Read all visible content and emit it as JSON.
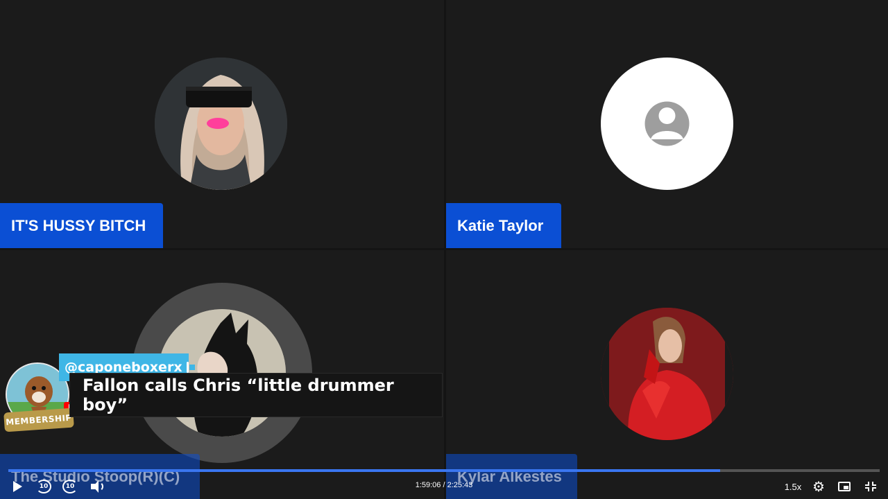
{
  "participants": [
    {
      "name": "IT'S HUSSY BITCH",
      "avatar": "photo-woman-sunglasses"
    },
    {
      "name": "Katie Taylor",
      "avatar": "default-person-icon"
    },
    {
      "name": "The Studio Stoop(R)(C)",
      "avatar": "illustration-cat-ear-woman"
    },
    {
      "name": "Kylar Alkestes",
      "avatar": "photo-woman-red-dress"
    }
  ],
  "comment": {
    "handle": "@caponeboxerx",
    "badge_label": "MEMBERSHIP",
    "text": "Fallon calls Chris “little drummer boy”"
  },
  "player": {
    "current_time": "1:59:06",
    "separator": " / ",
    "duration": "2:25:43",
    "time_display": "1:59:06 / 2:25:43",
    "speed": "1.5x",
    "progress_fraction": 0.817,
    "rewind_label": "10",
    "forward_label": "10",
    "accent_color": "#3a76f0"
  },
  "colors": {
    "nameplate": "#0b4fd4",
    "handle_bg": "#3fb6e6"
  }
}
